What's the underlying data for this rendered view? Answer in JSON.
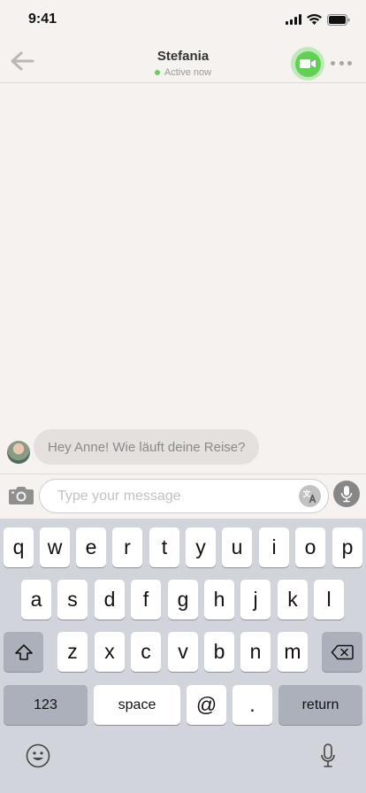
{
  "status_bar": {
    "time": "9:41"
  },
  "header": {
    "contact_name": "Stefania",
    "presence": "Active now",
    "presence_color": "#6ccf5f",
    "accent_color": "#64cf57",
    "icons": {
      "back": "arrow-left-icon",
      "video": "video-camera-icon",
      "more": "more-dots-icon"
    }
  },
  "messages": [
    {
      "sender": "Stefania",
      "text": "Hey Anne! Wie läuft deine Reise?",
      "incoming": true
    }
  ],
  "composer": {
    "placeholder": "Type your message",
    "value": "",
    "icons": {
      "camera": "camera-icon",
      "translate": "translate-icon",
      "mic": "microphone-icon"
    }
  },
  "keyboard": {
    "row1": [
      "q",
      "w",
      "e",
      "r",
      "t",
      "y",
      "u",
      "i",
      "o",
      "p"
    ],
    "row2": [
      "a",
      "s",
      "d",
      "f",
      "g",
      "h",
      "j",
      "k",
      "l"
    ],
    "row3": [
      "z",
      "x",
      "c",
      "v",
      "b",
      "n",
      "m"
    ],
    "numbers_label": "123",
    "space_label": "space",
    "at_label": "@",
    "period_label": ".",
    "return_label": "return",
    "icons": {
      "shift": "shift-icon",
      "backspace": "backspace-icon",
      "emoji": "emoji-icon",
      "dictation": "dictation-mic-icon"
    }
  }
}
